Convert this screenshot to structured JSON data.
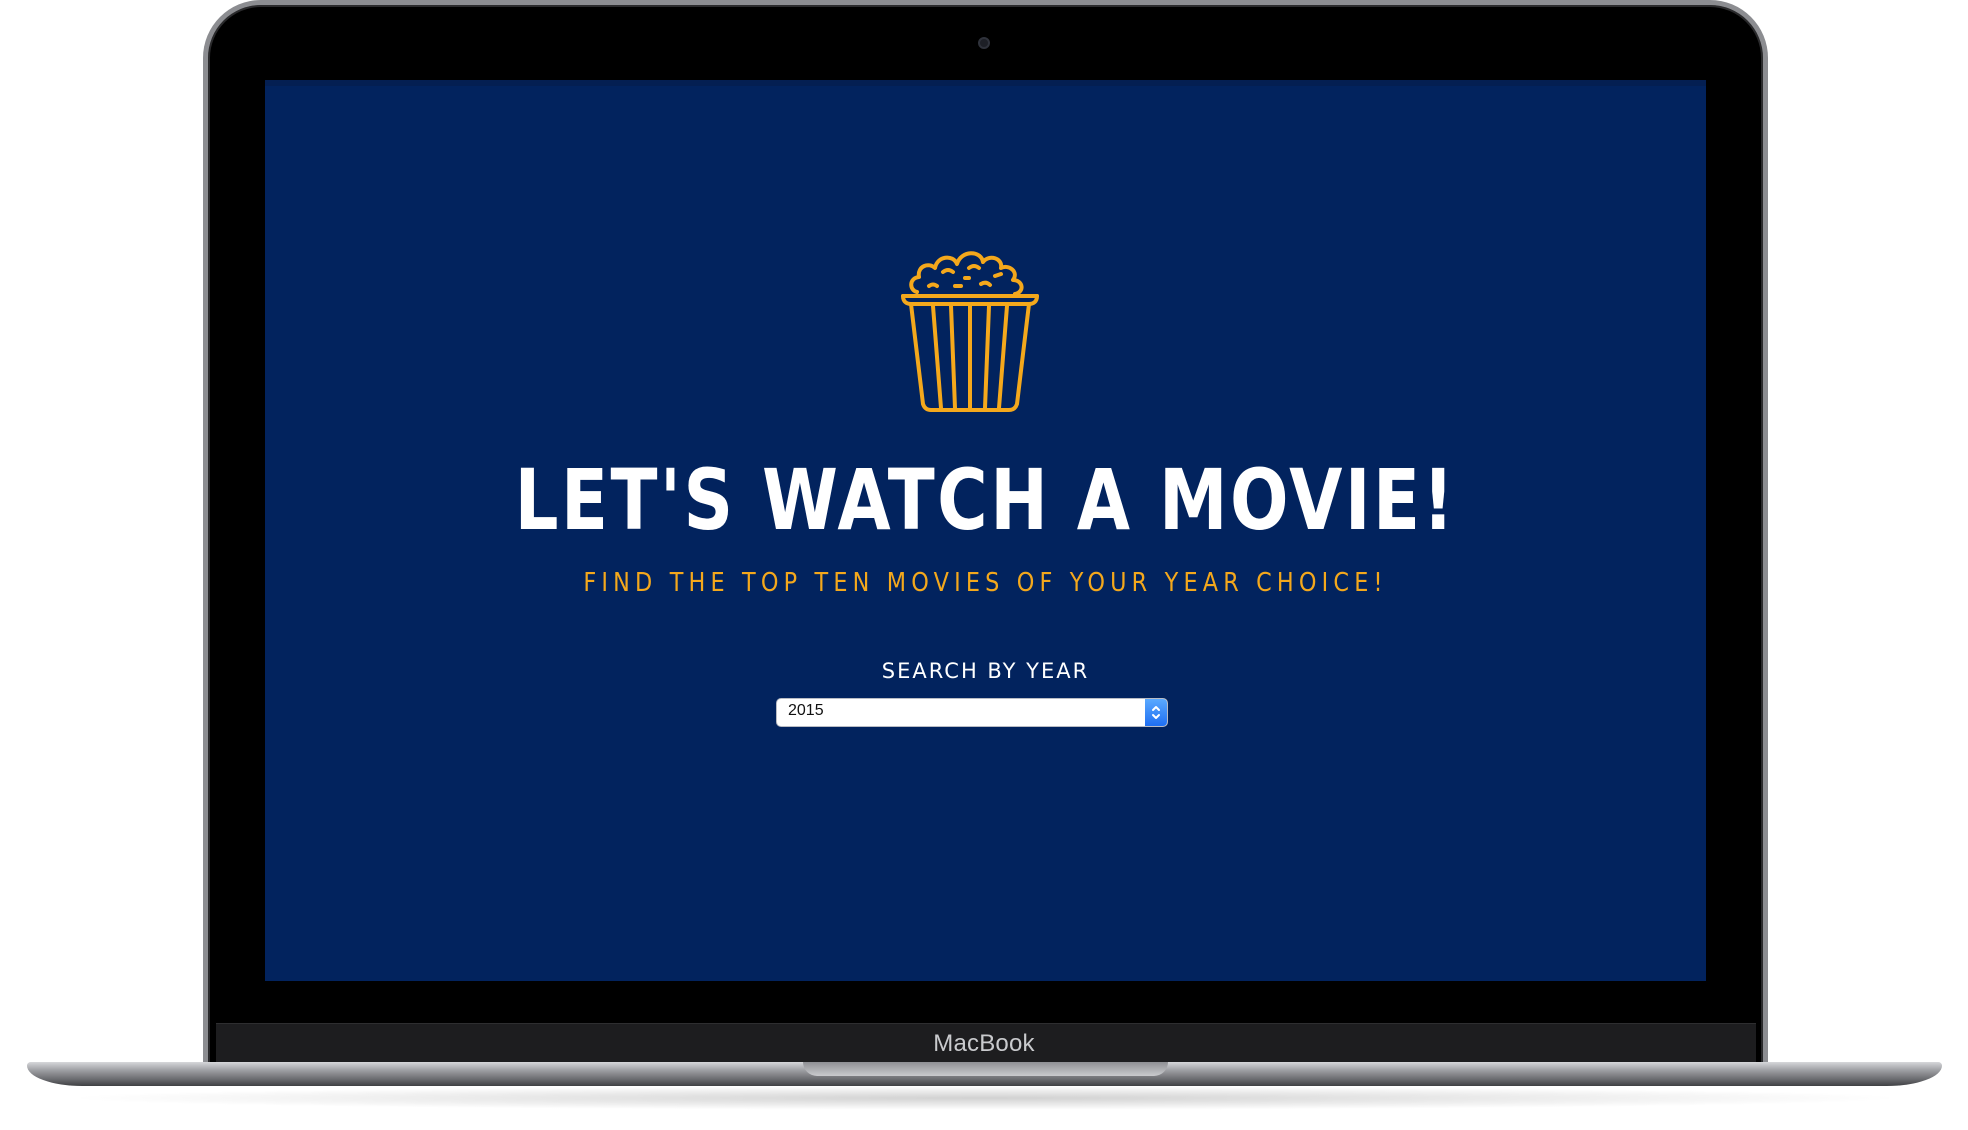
{
  "device": {
    "brand": "MacBook"
  },
  "page": {
    "title": "LET'S WATCH A MOVIE!",
    "subtitle": "FIND THE TOP TEN MOVIES OF YOUR YEAR CHOICE!",
    "search_label": "SEARCH BY YEAR",
    "year_select": {
      "selected": "2015"
    },
    "icon": "popcorn-bucket-icon"
  },
  "colors": {
    "background": "#02235e",
    "accent": "#f4a81c",
    "text": "#ffffff"
  }
}
